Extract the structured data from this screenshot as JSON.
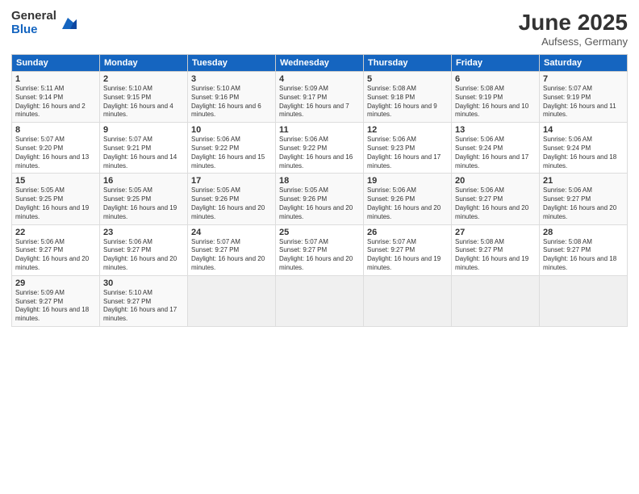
{
  "header": {
    "logo_general": "General",
    "logo_blue": "Blue",
    "title": "June 2025",
    "subtitle": "Aufsess, Germany"
  },
  "weekdays": [
    "Sunday",
    "Monday",
    "Tuesday",
    "Wednesday",
    "Thursday",
    "Friday",
    "Saturday"
  ],
  "weeks": [
    [
      {
        "day": "1",
        "sun": "5:11 AM",
        "set": "9:14 PM",
        "daylight": "16 hours and 2 minutes."
      },
      {
        "day": "2",
        "sun": "5:10 AM",
        "set": "9:15 PM",
        "daylight": "16 hours and 4 minutes."
      },
      {
        "day": "3",
        "sun": "5:10 AM",
        "set": "9:16 PM",
        "daylight": "16 hours and 6 minutes."
      },
      {
        "day": "4",
        "sun": "5:09 AM",
        "set": "9:17 PM",
        "daylight": "16 hours and 7 minutes."
      },
      {
        "day": "5",
        "sun": "5:08 AM",
        "set": "9:18 PM",
        "daylight": "16 hours and 9 minutes."
      },
      {
        "day": "6",
        "sun": "5:08 AM",
        "set": "9:19 PM",
        "daylight": "16 hours and 10 minutes."
      },
      {
        "day": "7",
        "sun": "5:07 AM",
        "set": "9:19 PM",
        "daylight": "16 hours and 11 minutes."
      }
    ],
    [
      {
        "day": "8",
        "sun": "5:07 AM",
        "set": "9:20 PM",
        "daylight": "16 hours and 13 minutes."
      },
      {
        "day": "9",
        "sun": "5:07 AM",
        "set": "9:21 PM",
        "daylight": "16 hours and 14 minutes."
      },
      {
        "day": "10",
        "sun": "5:06 AM",
        "set": "9:22 PM",
        "daylight": "16 hours and 15 minutes."
      },
      {
        "day": "11",
        "sun": "5:06 AM",
        "set": "9:22 PM",
        "daylight": "16 hours and 16 minutes."
      },
      {
        "day": "12",
        "sun": "5:06 AM",
        "set": "9:23 PM",
        "daylight": "16 hours and 17 minutes."
      },
      {
        "day": "13",
        "sun": "5:06 AM",
        "set": "9:24 PM",
        "daylight": "16 hours and 17 minutes."
      },
      {
        "day": "14",
        "sun": "5:06 AM",
        "set": "9:24 PM",
        "daylight": "16 hours and 18 minutes."
      }
    ],
    [
      {
        "day": "15",
        "sun": "5:05 AM",
        "set": "9:25 PM",
        "daylight": "16 hours and 19 minutes."
      },
      {
        "day": "16",
        "sun": "5:05 AM",
        "set": "9:25 PM",
        "daylight": "16 hours and 19 minutes."
      },
      {
        "day": "17",
        "sun": "5:05 AM",
        "set": "9:26 PM",
        "daylight": "16 hours and 20 minutes."
      },
      {
        "day": "18",
        "sun": "5:05 AM",
        "set": "9:26 PM",
        "daylight": "16 hours and 20 minutes."
      },
      {
        "day": "19",
        "sun": "5:06 AM",
        "set": "9:26 PM",
        "daylight": "16 hours and 20 minutes."
      },
      {
        "day": "20",
        "sun": "5:06 AM",
        "set": "9:27 PM",
        "daylight": "16 hours and 20 minutes."
      },
      {
        "day": "21",
        "sun": "5:06 AM",
        "set": "9:27 PM",
        "daylight": "16 hours and 20 minutes."
      }
    ],
    [
      {
        "day": "22",
        "sun": "5:06 AM",
        "set": "9:27 PM",
        "daylight": "16 hours and 20 minutes."
      },
      {
        "day": "23",
        "sun": "5:06 AM",
        "set": "9:27 PM",
        "daylight": "16 hours and 20 minutes."
      },
      {
        "day": "24",
        "sun": "5:07 AM",
        "set": "9:27 PM",
        "daylight": "16 hours and 20 minutes."
      },
      {
        "day": "25",
        "sun": "5:07 AM",
        "set": "9:27 PM",
        "daylight": "16 hours and 20 minutes."
      },
      {
        "day": "26",
        "sun": "5:07 AM",
        "set": "9:27 PM",
        "daylight": "16 hours and 19 minutes."
      },
      {
        "day": "27",
        "sun": "5:08 AM",
        "set": "9:27 PM",
        "daylight": "16 hours and 19 minutes."
      },
      {
        "day": "28",
        "sun": "5:08 AM",
        "set": "9:27 PM",
        "daylight": "16 hours and 18 minutes."
      }
    ],
    [
      {
        "day": "29",
        "sun": "5:09 AM",
        "set": "9:27 PM",
        "daylight": "16 hours and 18 minutes."
      },
      {
        "day": "30",
        "sun": "5:10 AM",
        "set": "9:27 PM",
        "daylight": "16 hours and 17 minutes."
      },
      null,
      null,
      null,
      null,
      null
    ]
  ]
}
